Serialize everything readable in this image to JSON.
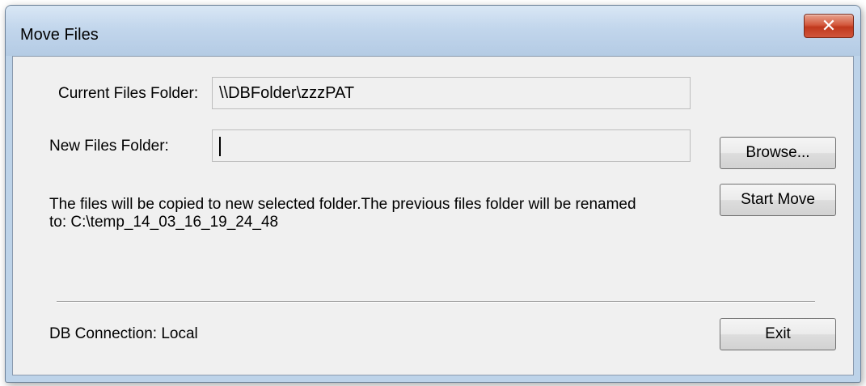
{
  "window": {
    "title": "Move Files",
    "close_glyph": "✕"
  },
  "form": {
    "current_folder_label": "Current Files Folder:",
    "current_folder_value": "\\\\DBFolder\\zzzPAT",
    "new_folder_label": "New Files Folder:",
    "new_folder_value": "",
    "message_line1": "The files will be copied to new selected folder.The previous files folder will be renamed",
    "message_line2": "to: C:\\temp_14_03_16_19_24_48",
    "db_connection": "DB Connection: Local"
  },
  "buttons": {
    "browse": "Browse...",
    "start_move": "Start Move",
    "exit": "Exit"
  },
  "colors": {
    "titlebar": "#c2d6ec",
    "close_button": "#c0391d",
    "client_bg": "#f0f0f0"
  }
}
